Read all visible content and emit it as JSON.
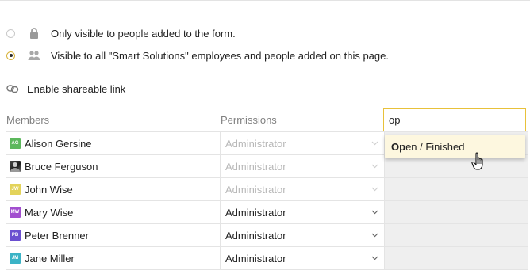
{
  "visibility": {
    "option_private": {
      "label": "Only visible to people added to the form.",
      "checked": false,
      "icon": "lock-icon"
    },
    "option_all": {
      "label": "Visible to all \"Smart Solutions\" employees and people added on this page.",
      "checked": true,
      "icon": "users-icon"
    }
  },
  "shareable": {
    "label": "Enable shareable link",
    "icon": "link-icon"
  },
  "table": {
    "members_header": "Members",
    "permissions_header": "Permissions",
    "rows": [
      {
        "name": "Alison Gersine",
        "initials": "AG",
        "avatar_color": "#5cb85c",
        "permission": "Administrator",
        "disabled": true
      },
      {
        "name": "Bruce Ferguson",
        "initials": "",
        "avatar_color": "#333333",
        "permission": "Administrator",
        "disabled": true
      },
      {
        "name": "John Wise",
        "initials": "JW",
        "avatar_color": "#e3d35a",
        "permission": "Administrator",
        "disabled": true
      },
      {
        "name": "Mary Wise",
        "initials": "MW",
        "avatar_color": "#a24fcf",
        "permission": "Administrator",
        "disabled": false
      },
      {
        "name": "Peter Brenner",
        "initials": "PB",
        "avatar_color": "#6a4fd0",
        "permission": "Administrator",
        "disabled": false
      },
      {
        "name": "Jane Miller",
        "initials": "JM",
        "avatar_color": "#3bb3c6",
        "permission": "Administrator",
        "disabled": false
      }
    ]
  },
  "search": {
    "value": "op",
    "suggestion_match": "Op",
    "suggestion_rest": "en / Finished"
  },
  "colors": {
    "accent": "#e8c13a",
    "dropdown_bg": "#fdf7df"
  }
}
